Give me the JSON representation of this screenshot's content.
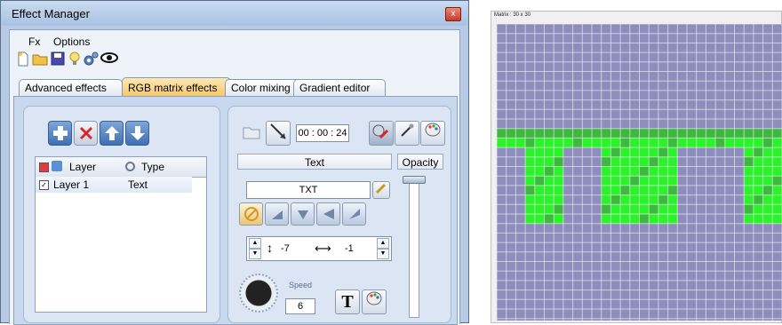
{
  "window": {
    "title": "Effect Manager",
    "close_glyph": "x"
  },
  "menu": {
    "items": [
      "Fx",
      "Options"
    ]
  },
  "toolbar": {
    "icons": [
      "new-file-icon",
      "open-folder-icon",
      "save-icon",
      "bulb-icon",
      "gears-icon",
      "eye-icon"
    ]
  },
  "tabs": [
    {
      "label": "Advanced effects",
      "active": false
    },
    {
      "label": "RGB matrix effects",
      "active": true
    },
    {
      "label": "Color mixing",
      "active": false
    },
    {
      "label": "Gradient editor",
      "active": false
    }
  ],
  "layers": {
    "buttons": [
      "add-layer",
      "delete-layer",
      "move-up",
      "move-down"
    ],
    "col_layer": "Layer",
    "col_type": "Type",
    "rows": [
      {
        "name": "Layer 1",
        "type": "Text",
        "checked": true
      }
    ]
  },
  "effect": {
    "time": "00 : 00 : 24",
    "text_header": "Text",
    "opacity_header": "Opacity",
    "text_value": "TXT",
    "offset_y": "-7",
    "offset_x": "-1",
    "speed_label": "Speed",
    "speed_value": "6",
    "font_glyph": "T",
    "opacity": 1.0
  },
  "matrix": {
    "title": "Matrix : 30 x 30",
    "rows": 30,
    "cols": 30,
    "colors": {
      "background": "#8e8ebd",
      "lit": "#2cf22c",
      "dim": "#3fb83f",
      "grid": "#ffffff"
    }
  }
}
